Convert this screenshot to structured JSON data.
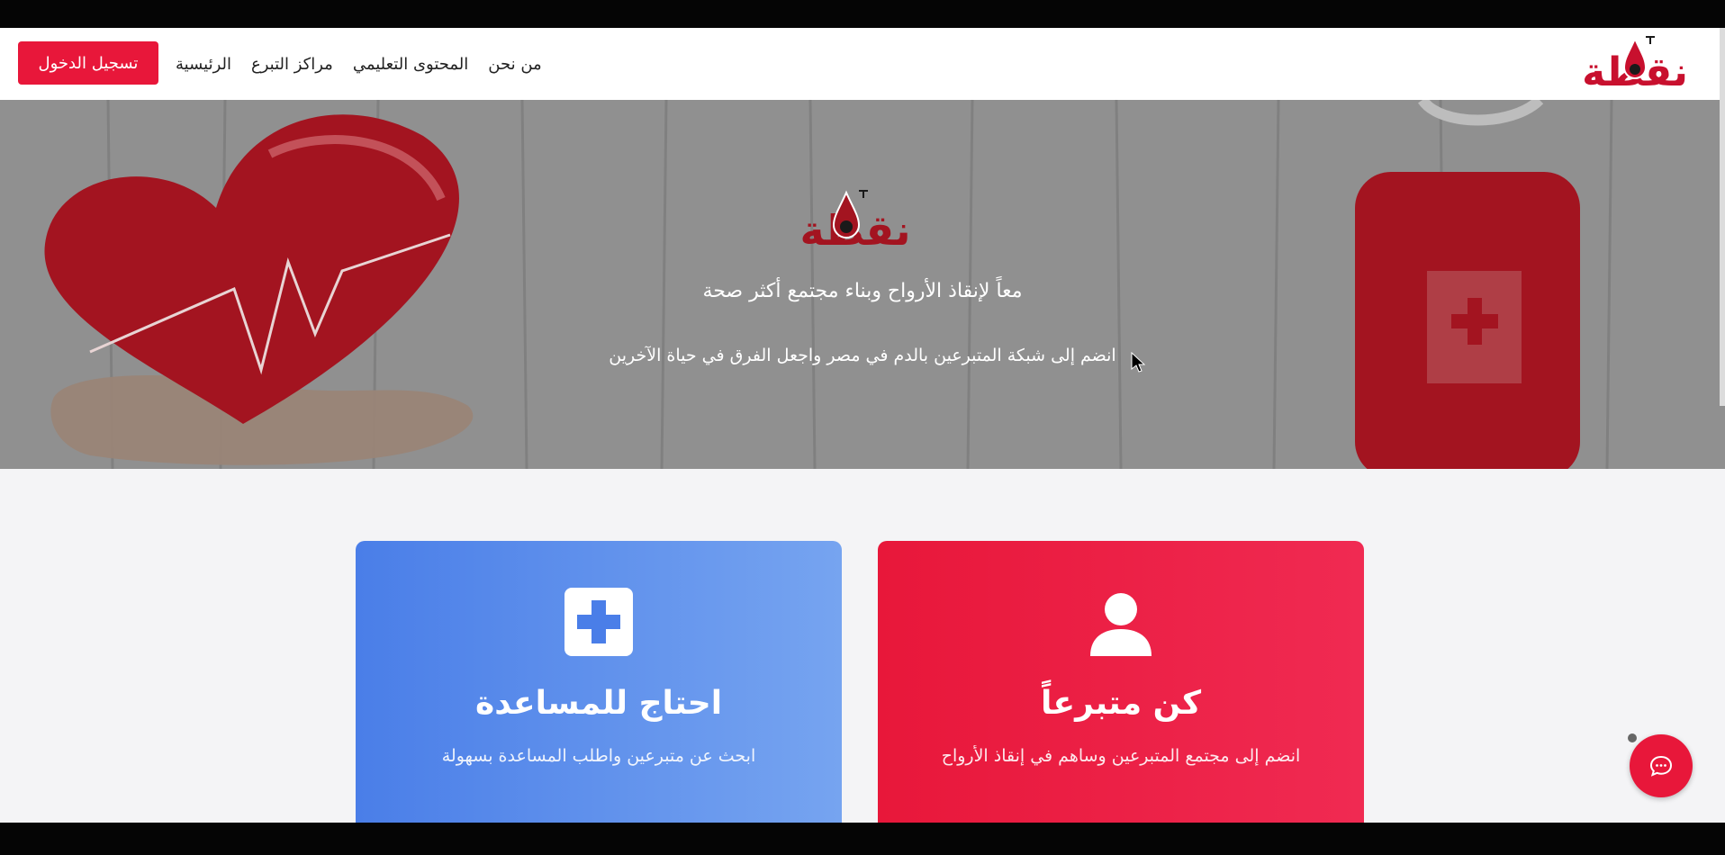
{
  "colors": {
    "brand_red": "#e8173a",
    "brand_blue": "#4a7ee8",
    "hero_bg": "#8e8e8e"
  },
  "navbar": {
    "brand_logo_text": "نقطة",
    "login_label": "تسجيل الدخول",
    "links": [
      {
        "label": "الرئيسية"
      },
      {
        "label": "مراكز التبرع"
      },
      {
        "label": "المحتوى التعليمي"
      },
      {
        "label": "من نحن"
      }
    ]
  },
  "hero": {
    "logo_text": "نقطة",
    "title": "معاً لإنقاذ الأرواح وبناء مجتمع أكثر صحة",
    "subtitle": "انضم إلى شبكة المتبرعين بالدم في مصر واجعل الفرق في حياة الآخرين"
  },
  "cards": {
    "need_help": {
      "icon": "medical-cross-icon",
      "title": "احتاج للمساعدة",
      "text": "ابحث عن متبرعين واطلب المساعدة بسهولة"
    },
    "become_donor": {
      "icon": "user-icon",
      "title": "كن متبرعاً",
      "text": "انضم إلى مجتمع المتبرعين وساهم في إنقاذ الأرواح"
    }
  },
  "chat": {
    "icon": "chat-icon"
  }
}
